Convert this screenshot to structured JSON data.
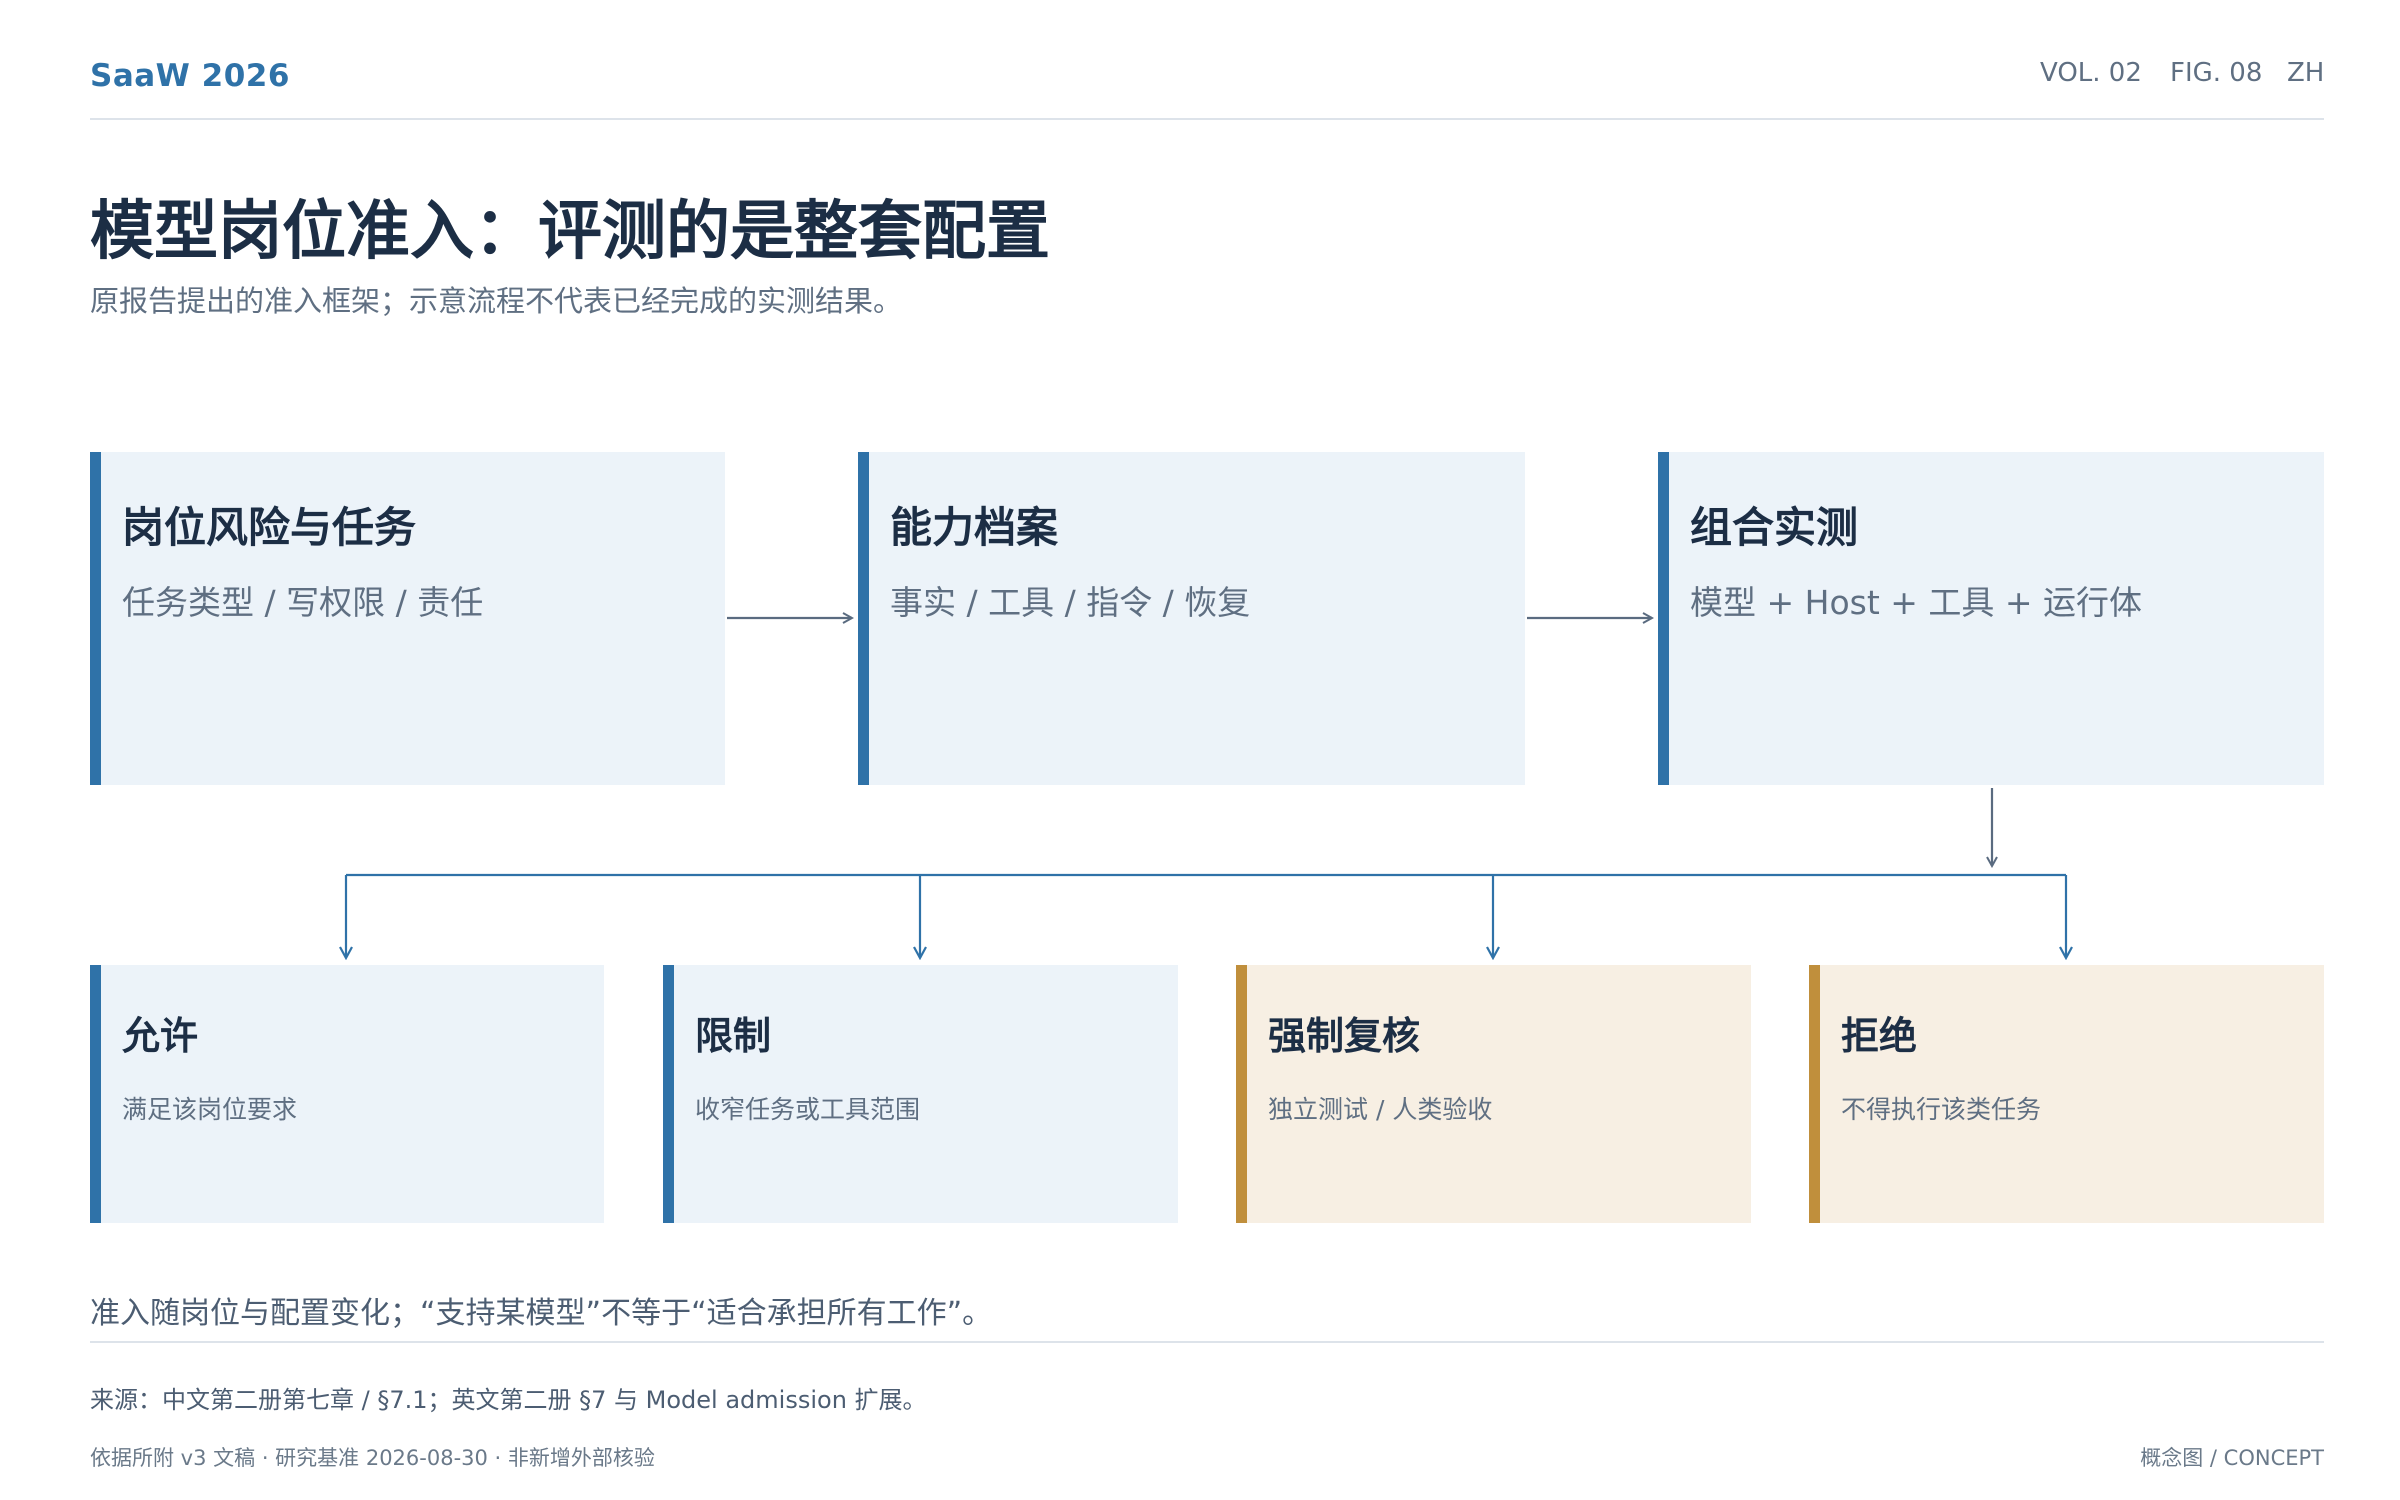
{
  "header": {
    "brand": "SaaW 2026",
    "volume": "VOL. 02",
    "figure": "FIG. 08",
    "language": "ZH"
  },
  "title": "模型岗位准入：评测的是整套配置",
  "subtitle": "原报告提出的准入框架；示意流程不代表已经完成的实测结果。",
  "flow": [
    {
      "title": "岗位风险与任务",
      "desc": "任务类型 / 写权限 / 责任"
    },
    {
      "title": "能力档案",
      "desc": "事实 / 工具 / 指令 / 恢复"
    },
    {
      "title": "组合实测",
      "desc": "模型 + Host + 工具 + 运行体"
    }
  ],
  "outcomes": [
    {
      "title": "允许",
      "desc": "满足该岗位要求",
      "tone": "normal"
    },
    {
      "title": "限制",
      "desc": "收窄任务或工具范围",
      "tone": "normal"
    },
    {
      "title": "强制复核",
      "desc": "独立测试 / 人类验收",
      "tone": "warn"
    },
    {
      "title": "拒绝",
      "desc": "不得执行该类任务",
      "tone": "warn"
    }
  ],
  "note": "准入随岗位与配置变化；“支持某模型”不等于“适合承担所有工作”。",
  "source": "来源：中文第二册第七章 / §7.1；英文第二册 §7 与 Model admission 扩展。",
  "footer": {
    "left": "依据所附 v3 文稿 · 研究基准 2026-08-30 · 非新增外部核验",
    "right": "概念图 / CONCEPT"
  },
  "colors": {
    "accent": "#2f72a8",
    "warn": "#c08f3c",
    "box_fill": "#ecf3f9",
    "warn_fill": "#f7efe3",
    "arrow": "#5a6b80"
  }
}
